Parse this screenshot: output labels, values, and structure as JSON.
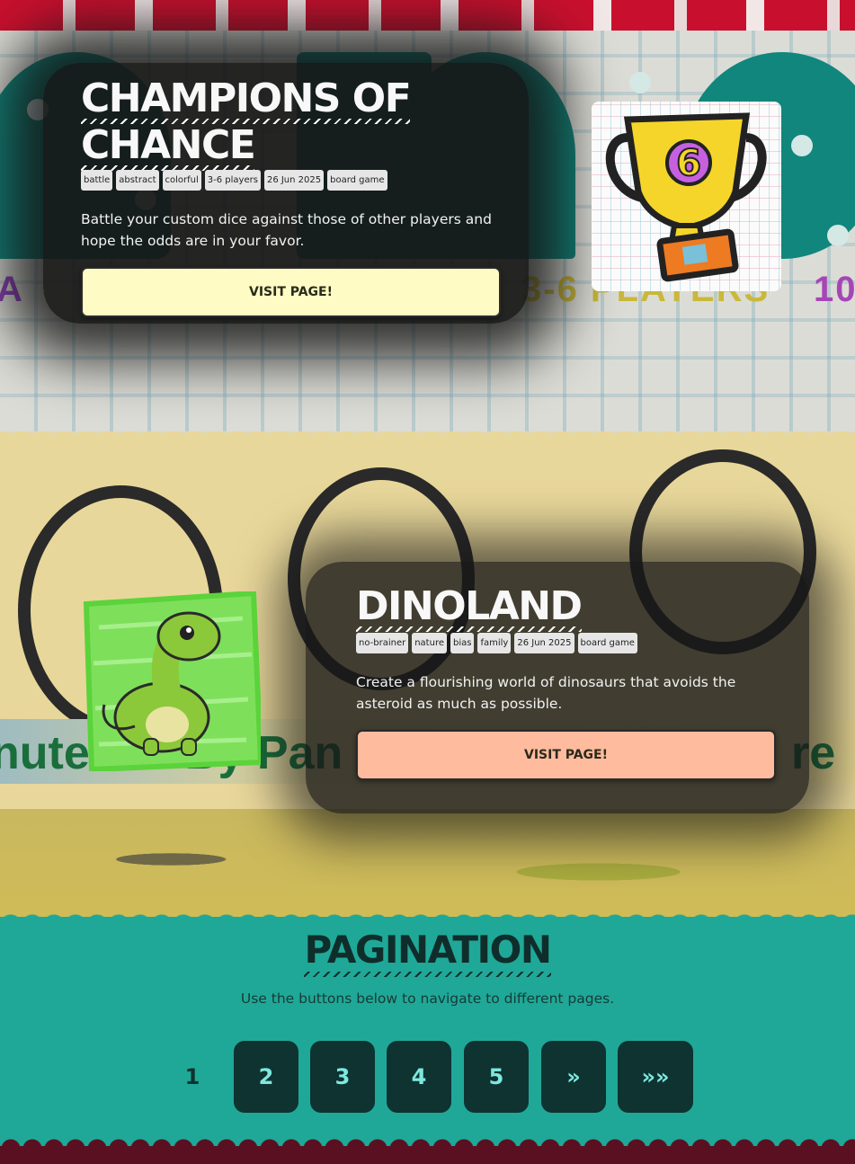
{
  "games": [
    {
      "title_lines": [
        "CHAMPIONS OF",
        "CHANCE"
      ],
      "tags": [
        "battle",
        "abstract",
        "colorful",
        "3-6 players",
        "26 Jun 2025",
        "board game"
      ],
      "description": "Battle your custom dice against those of other players and hope the odds are in your favor.",
      "button_label": "VISIT PAGE!",
      "button_color": "#fefbc4",
      "thumbnail": "trophy-six-icon"
    },
    {
      "title_lines": [
        "DINOLAND"
      ],
      "tags": [
        "no-brainer",
        "nature",
        "bias",
        "family",
        "26 Jun 2025",
        "board game"
      ],
      "description": "Create a flourishing world of dinosaurs that avoids the asteroid as much as possible.",
      "button_label": "VISIT PAGE!",
      "button_color": "#ffbb9e",
      "thumbnail": "green-dinosaur-icon"
    }
  ],
  "pagination": {
    "title": "PAGINATION",
    "subtitle": "Use the buttons below to navigate to different pages.",
    "current": "1",
    "pages": [
      "2",
      "3",
      "4",
      "5"
    ],
    "next_label": "»",
    "last_label": "»»"
  },
  "colors": {
    "teal": "#1fa898",
    "dark_teal": "#0e3331",
    "page_button_text": "#7fe8de",
    "footer": "#5a1020"
  }
}
